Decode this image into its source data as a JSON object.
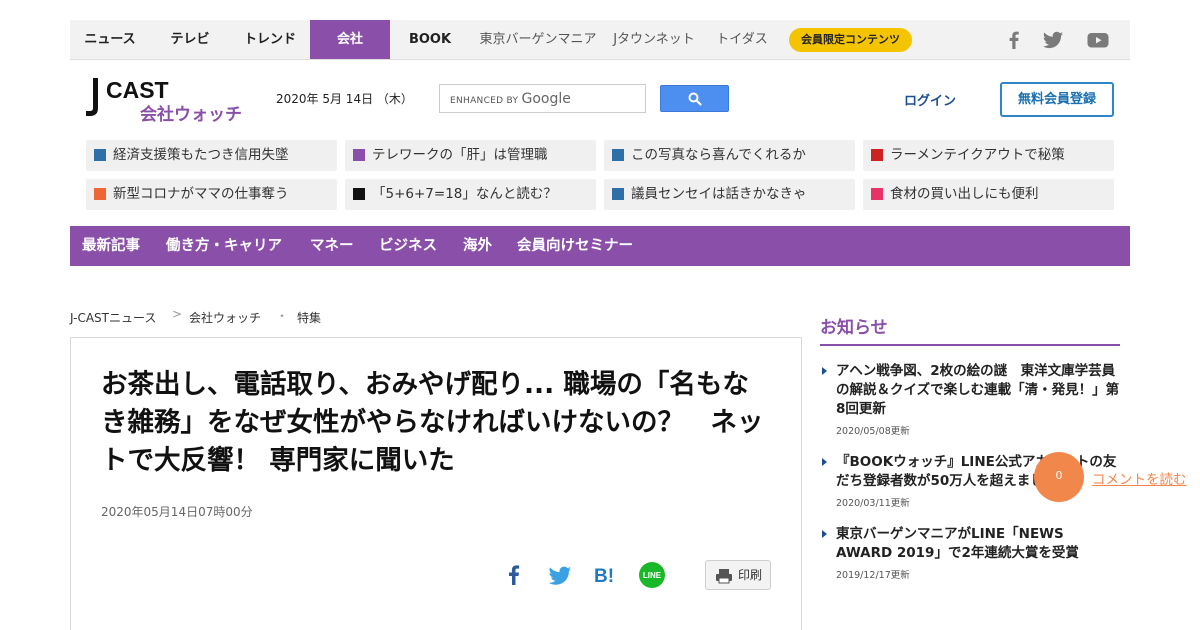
{
  "top_nav": {
    "items": [
      {
        "label": "ニュース"
      },
      {
        "label": "テレビ"
      },
      {
        "label": "トレンド"
      },
      {
        "label": "会社",
        "active": true
      },
      {
        "label": "BOOK"
      },
      {
        "label": "東京バーゲンマニア"
      },
      {
        "label": "Jタウンネット"
      },
      {
        "label": "トイダス"
      }
    ],
    "member_badge": "会員限定コンテンツ",
    "social_icons": [
      "facebook-icon",
      "twitter-icon",
      "youtube-icon"
    ]
  },
  "header": {
    "logo_top": "CAST",
    "logo_sub": "会社ウォッチ",
    "date": "2020年 5月 14日 （木）",
    "search_placeholder": "ENHANCED BY",
    "search_brand": "Google",
    "login": "ログイン",
    "register": "無料会員登録"
  },
  "topics": [
    {
      "label": "経済支援策もたつき信用失墜",
      "color": "#2f6fa8"
    },
    {
      "label": "テレワークの「肝」は管理職",
      "color": "#8a4fa8"
    },
    {
      "label": "この写真なら喜んでくれるか",
      "color": "#2f6fa8"
    },
    {
      "label": "ラーメンテイクアウトで秘策",
      "color": "#cc2222"
    },
    {
      "label": "新型コロナがママの仕事奪う",
      "color": "#ee6633"
    },
    {
      "label": "「5+6+7=18」なんと読む？",
      "color": "#111111"
    },
    {
      "label": "議員センセイは話きかなきゃ",
      "color": "#2f6fa8"
    },
    {
      "label": "食材の買い出しにも便利",
      "color": "#e8336a"
    }
  ],
  "categories": [
    {
      "label": "最新記事"
    },
    {
      "label": "働き方・キャリア"
    },
    {
      "label": "マネー"
    },
    {
      "label": "ビジネス"
    },
    {
      "label": "海外"
    },
    {
      "label": "会員向けセミナー"
    }
  ],
  "breadcrumb": {
    "items": [
      {
        "label": "J-CASTニュース"
      },
      {
        "label": "会社ウォッチ"
      },
      {
        "label": "特集"
      }
    ],
    "separators": [
      ">",
      "・"
    ]
  },
  "article": {
    "title": "お茶出し、電話取り、おみやげ配り... 職場の「名もなき雑務」をなぜ女性がやらなければいけないの？　ネットで大反響！ 専門家に聞いた",
    "published": "2020年05月14日07時00分",
    "print_label": "印刷",
    "share_icons": [
      "facebook-icon",
      "twitter-icon",
      "hatena-bookmark-icon",
      "line-icon"
    ],
    "line_badge_text": "LINE",
    "hatena_text": "B!"
  },
  "sidebar": {
    "heading": "お知らせ",
    "news": [
      {
        "title": "アヘン戦争図、2枚の絵の謎　東洋文庫学芸員の解説＆クイズで楽しむ連載「清・発見！」第8回更新",
        "date": "2020/05/08更新"
      },
      {
        "title": "『BOOKウォッチ』LINE公式アカウントの友だち登録者数が50万人を超えました",
        "date": "2020/03/11更新"
      },
      {
        "title": "東京バーゲンマニアがLINE「NEWS AWARD 2019」で2年連続大賞を受賞",
        "date": "2019/12/17更新"
      }
    ]
  },
  "comment": {
    "count": "0",
    "label": "コメントを読む"
  },
  "colors": {
    "accent": "#8a4fa8",
    "badge": "#f5c400",
    "link_blue": "#1a4f91",
    "comment_orange": "#f2874c"
  }
}
